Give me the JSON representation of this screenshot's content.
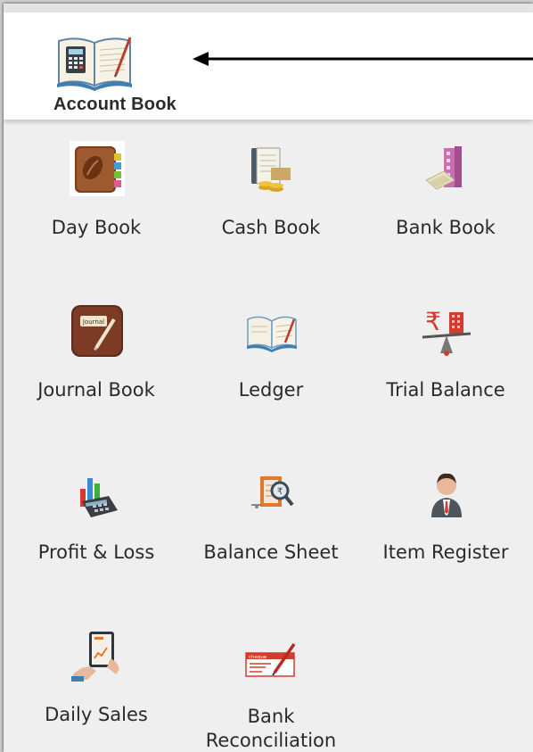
{
  "header": {
    "title": "Account Book",
    "icon": "account-book-icon"
  },
  "tiles": [
    {
      "label": "Day Book",
      "icon": "day-book-icon"
    },
    {
      "label": "Cash Book",
      "icon": "cash-book-icon"
    },
    {
      "label": "Bank Book",
      "icon": "bank-book-icon"
    },
    {
      "label": "Journal Book",
      "icon": "journal-book-icon"
    },
    {
      "label": "Ledger",
      "icon": "ledger-icon"
    },
    {
      "label": "Trial Balance",
      "icon": "trial-balance-icon"
    },
    {
      "label": "Profit & Loss",
      "icon": "profit-loss-icon"
    },
    {
      "label": "Balance Sheet",
      "icon": "balance-sheet-icon"
    },
    {
      "label": "Item Register",
      "icon": "item-register-icon"
    },
    {
      "label": "Daily Sales",
      "icon": "daily-sales-icon"
    },
    {
      "label_line1": "Bank",
      "label_line2": "Reconciliation",
      "icon": "bank-reconciliation-icon"
    }
  ],
  "journal_icon_text": "Journal",
  "cheque_icon_text": "cheque",
  "colors": {
    "background": "#efefef",
    "header": "#ffffff",
    "label": "#2a2a2a"
  }
}
